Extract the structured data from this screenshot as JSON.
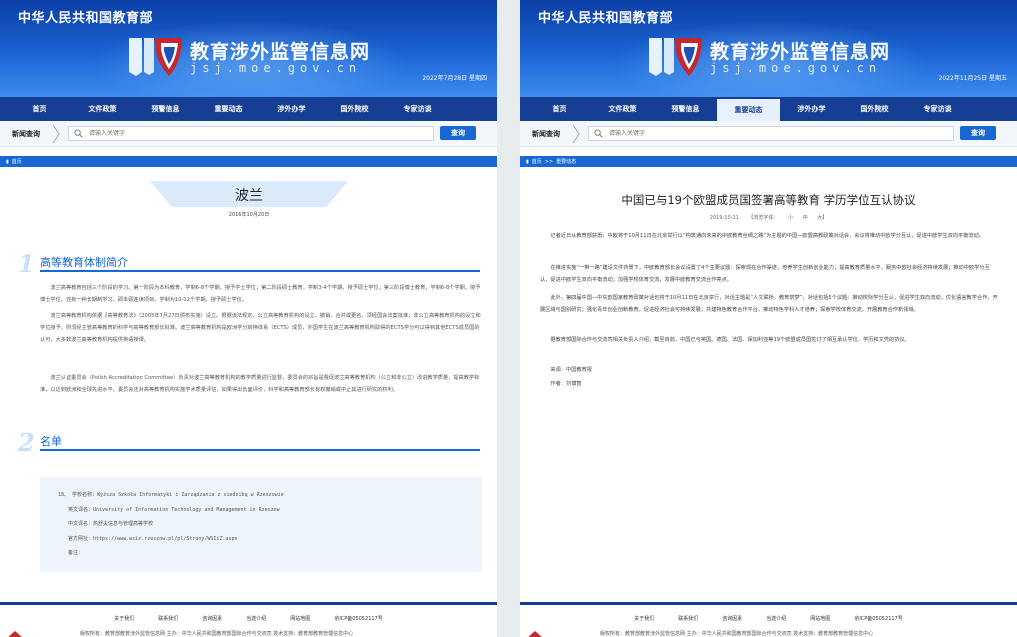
{
  "ministry": "中华人民共和国教育部",
  "site_title": "教育涉外监管信息网",
  "site_domain": "jsj.moe.gov.cn",
  "nav": [
    "首页",
    "文件政策",
    "预警信息",
    "重要动态",
    "涉外办学",
    "国外院校",
    "专家访谈"
  ],
  "search": {
    "label": "新闻查询",
    "placeholder": "请输入关键字",
    "button": "查询"
  },
  "footer": {
    "links": [
      "关于我们",
      "联系我们",
      "咨询因素",
      "当选介绍",
      "网站地图",
      "京ICP备05052117号"
    ],
    "note": "版权所有：教育部教育涉外监管信息网 主办：中华人民共和国教育部国际合作与交流司 技术支持：教育部教育管理信息中心"
  },
  "left": {
    "date": "2022年7月28日 星期四",
    "breadcrumb": [
      "首页"
    ],
    "page_title": "波兰",
    "page_date": "2016年10月20日",
    "section1": {
      "num": "1",
      "title": "高等教育体制简介"
    },
    "paragraphs": [
      "波兰高等教育包括三个阶段的学习。第一阶段为本科教育，学制6-8个学期，授予学士学位；第二阶段硕士教育，学制3-4个学期，授予硕士学位；第三阶段博士教育，学制6-8个学期，授予博士学位。还有一种长期制学习，即本硕连读项目，学制为10-12个学期，授予硕士学位。",
      "波兰高等教育机构依据《高等教育法》（2005年7月27日颁布实施）设立。根据该法规定，公立高等教育机构的设立、撤销、合并或更名，须经国会法案批准；非公立高等教育机构的设立和学位授予，则须经主管高等教育的科学与高等教育部长批准。波兰高等教育机构是欧洲学分转换体系（ECTS）成员，外国学生在波兰高等教育机构取得的ECTS学分可以得到其他ECTS成员国的认可，大多数波兰高等教育机构提供英语授课。",
      "波兰认证委员会（Polish Accreditation Committee）负责对波兰高等教育机构的教学质量进行监督，委员会的宗旨是督促波兰高等教育机构（公立和非公立）改进教学质量，提高教学标准，以达到欧洲和全球先进水平。委员会还对高等教育机构实施学术质量评估，如果得出负面评价，科学和高等教育部长有权撤销或中止其进行研究的权利。"
    ],
    "section2": {
      "num": "2",
      "title": "名单"
    },
    "school": {
      "number": "18、",
      "name_label": "学校名称：",
      "name": "Wyższa Szkoła Informatyki i Zarządzania z siedzibą w Rzeszowie",
      "en_label": "英文译名：",
      "en": "University of Information Technology and Management in Rzeszow",
      "cn_label": "中文译名：",
      "cn": "热舒夫信息与管理高等学校",
      "url_label": "官方网址：",
      "url": "https://www.wsiz.rzeszow.pl/pl/Strony/WSIiZ.aspx",
      "note_label": "备注："
    }
  },
  "right": {
    "date": "2022年11月25日 星期五",
    "active_nav": "重要动态",
    "breadcrumb": [
      "首页",
      ">>",
      "重要动态"
    ],
    "article_title": "中国已与19个欧盟成员国签署高等教育 学历学位互认协议",
    "meta": {
      "date": "2019-10-11",
      "font_label": "【浏览字体：",
      "small": "小",
      "medium": "中",
      "large": "大】"
    },
    "paragraphs": [
      "记者近日从教育部获悉，中欧将于10月11日在北京举行以“构筑通向未来的中欧教育丝绸之路”为主题的中国—欧盟高教政策对话会，会议将推动中欧学分互认，促进中欧学生双向平衡流动。",
      "在推进实施“一带一路”建设文件背景下，中欧教育部长会议设置了4个主要议题：探索现在合作渠道，培养学生创新创业能力；提高教育质量水平，服务中欧社会经济持续发展；推动中欧学分互认，促进中欧学生双向平衡流动；加强学校体育交流，发展中欧教育交流合作亮点。",
      "此外，第四届中国—中东欧国家教育政策对话也将于10月11日在北京举行，对话主题是“人文联桥，教育筑梦”，对话包括5个议题：推动校际学分互认，促进学生双向流动；优化语言教学合作，开展区域与国别研究；强化青年创业创新教育，促进经济社会可持续发展；共建特色教育合作平台，推动特色学科人才培养；探索学校体育交流，开展教育合作新领域。",
      "据教育部国际合作与交流司相关负责人介绍，截至目前，中国已与英国、德国、法国、保加利亚等19个欧盟成员国签订了相互承认学位、学历和文凭的协议。"
    ],
    "source": "来源：中国教育报",
    "author": "作者：刘博智"
  }
}
